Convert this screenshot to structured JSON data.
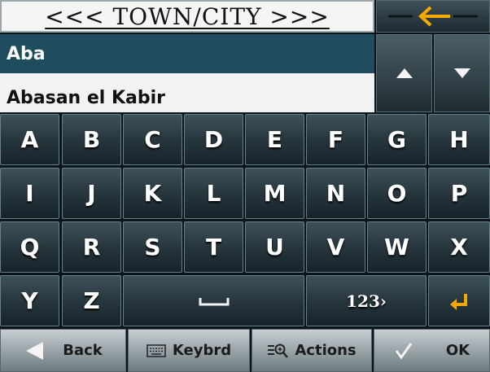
{
  "header": {
    "title": "<<< TOWN/CITY >>>",
    "back_icon": "left-arrow-icon",
    "accent": "#f5a800"
  },
  "results": [
    {
      "label": "Aba",
      "selected": true
    },
    {
      "label": "Abasan el Kabir",
      "selected": false
    }
  ],
  "scroll": {
    "up_icon": "triangle-up-icon",
    "down_icon": "triangle-down-icon"
  },
  "keyboard": {
    "row1": [
      "A",
      "B",
      "C",
      "D",
      "E",
      "F",
      "G",
      "H"
    ],
    "row2": [
      "I",
      "J",
      "K",
      "L",
      "M",
      "N",
      "O",
      "P"
    ],
    "row3": [
      "Q",
      "R",
      "S",
      "T",
      "U",
      "V",
      "W",
      "X"
    ],
    "row4": {
      "y": "Y",
      "z": "Z",
      "space_icon": "space-bar-icon",
      "numeric": "123›",
      "enter_icon": "enter-icon"
    }
  },
  "toolbar": {
    "back": "Back",
    "keyboard": "Keybrd",
    "actions": "Actions",
    "ok": "OK"
  }
}
